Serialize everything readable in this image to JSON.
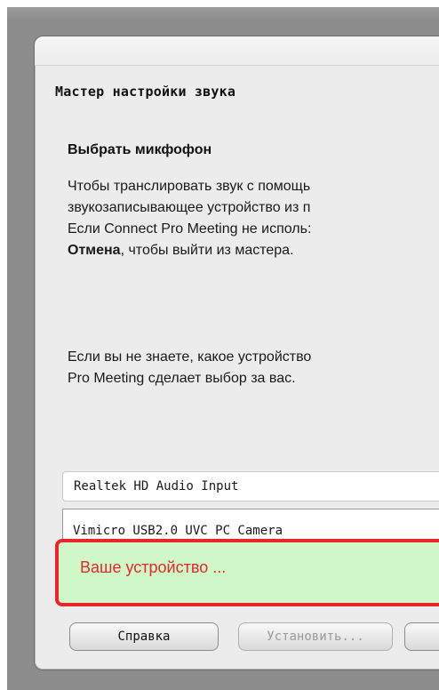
{
  "wizard": {
    "title": "Мастер настройки звука",
    "heading": "Выбрать микфофон",
    "paragraph1": {
      "line1": "Чтобы транслировать звук с помощь",
      "line2": "звукозаписывающее устройство из п",
      "line3": "Если Connect Pro Meeting не исполь:",
      "line4_bold": "Отмена",
      "line4_rest": ", чтобы выйти из мастера."
    },
    "paragraph2": {
      "line1": "Если вы не знаете, какое устройство",
      "line2": "Pro Meeting сделает выбор за вас."
    },
    "selected_device": "Realtek HD Audio Input",
    "device_options": [
      "Vimicro USB2.0 UVC PC Camera"
    ],
    "highlight_text": "Ваше устройство ...",
    "buttons": {
      "help": "Справка",
      "install": "Установить..."
    }
  }
}
